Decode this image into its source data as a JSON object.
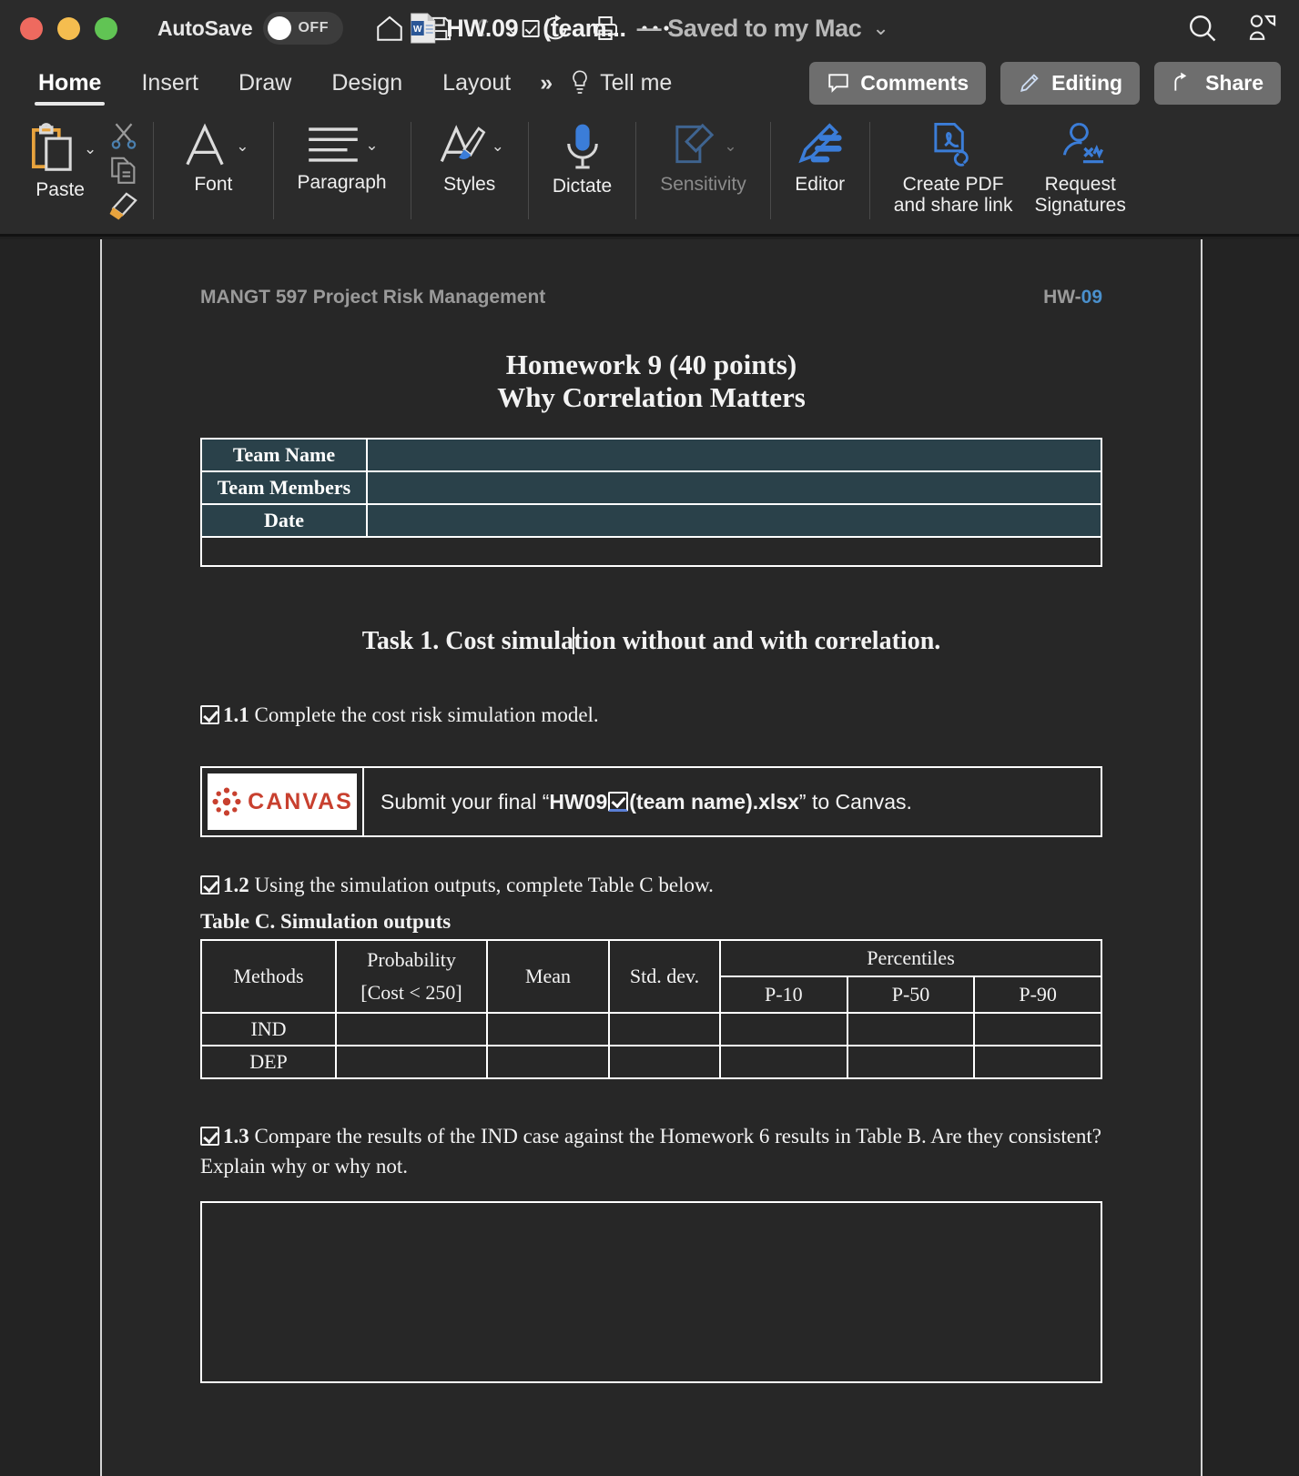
{
  "window": {
    "traffic_lights": [
      "close",
      "minimize",
      "maximize"
    ],
    "autosave_label": "AutoSave",
    "autosave_state": "OFF",
    "doc_title": "HW.09",
    "doc_title_tail": "(team...",
    "doc_status": "— Saved to my Mac",
    "quick_access": [
      "home-icon",
      "save-icon",
      "undo-icon",
      "redo-icon",
      "print-icon",
      "more-icon"
    ],
    "right_icons": [
      "search-icon",
      "collab-icon"
    ]
  },
  "ribbon": {
    "tabs": [
      {
        "label": "Home",
        "active": true
      },
      {
        "label": "Insert",
        "active": false
      },
      {
        "label": "Draw",
        "active": false
      },
      {
        "label": "Design",
        "active": false
      },
      {
        "label": "Layout",
        "active": false
      }
    ],
    "overflow": "»",
    "tell_me": "Tell me",
    "actions": [
      {
        "label": "Comments",
        "icon": "comment-icon"
      },
      {
        "label": "Editing",
        "icon": "pencil-icon"
      },
      {
        "label": "Share",
        "icon": "share-icon"
      }
    ],
    "groups": [
      {
        "label": "Paste",
        "icon": "clipboard-icon",
        "dropdown": true,
        "dim": false
      },
      {
        "label": "Font",
        "icon": "font-a-icon",
        "dropdown": true,
        "dim": false
      },
      {
        "label": "Paragraph",
        "icon": "paragraph-lines-icon",
        "dropdown": true,
        "dim": false
      },
      {
        "label": "Styles",
        "icon": "styles-brush-icon",
        "dropdown": true,
        "dim": false
      },
      {
        "label": "Dictate",
        "icon": "microphone-icon",
        "dropdown": false,
        "dim": false
      },
      {
        "label": "Sensitivity",
        "icon": "sensitivity-icon",
        "dropdown": true,
        "dim": true
      },
      {
        "label": "Editor",
        "icon": "editor-pen-icon",
        "dropdown": false,
        "dim": false
      },
      {
        "label": "Create PDF\nand share link",
        "icon": "pdf-link-icon",
        "dropdown": false,
        "dim": false
      },
      {
        "label": "Request\nSignatures",
        "icon": "signature-icon",
        "dropdown": false,
        "dim": false
      }
    ],
    "mini_tools": [
      "cut-scissors-icon",
      "copy-icon",
      "format-painter-icon"
    ]
  },
  "document": {
    "header_left": "MANGT 597 Project Risk Management",
    "header_right_gray": "HW-",
    "header_right_blue": "09",
    "title_line1": "Homework 9 (40 points)",
    "title_line2": "Why Correlation Matters",
    "team_table": {
      "rows": [
        {
          "label": "Team Name",
          "value": ""
        },
        {
          "label": "Team Members",
          "value": ""
        },
        {
          "label": "Date",
          "value": ""
        }
      ]
    },
    "task_heading_pre": "Task 1. Cost simula",
    "task_heading_post": "tion without and with correlation.",
    "item_1_1": {
      "number": "1.1",
      "text": "Complete the cost risk simulation model."
    },
    "canvas_box": {
      "logo_text": "CANVAS",
      "prefix": "Submit your final “",
      "bold_a": "HW09",
      "bold_b": "(team name).xlsx",
      "suffix": "” to Canvas."
    },
    "item_1_2": {
      "number": "1.2",
      "text": "Using the simulation outputs, complete Table C below."
    },
    "table_c_caption": "Table C. Simulation outputs",
    "table_c": {
      "headers": {
        "methods": "Methods",
        "probability_line1": "Probability",
        "probability_line2": "[Cost < 250]",
        "mean": "Mean",
        "std_dev": "Std. dev.",
        "percentiles": "Percentiles",
        "p10": "P-10",
        "p50": "P-50",
        "p90": "P-90"
      },
      "rows": [
        {
          "method": "IND",
          "probability": "",
          "mean": "",
          "std_dev": "",
          "p10": "",
          "p50": "",
          "p90": ""
        },
        {
          "method": "DEP",
          "probability": "",
          "mean": "",
          "std_dev": "",
          "p10": "",
          "p50": "",
          "p90": ""
        }
      ]
    },
    "item_1_3": {
      "number": "1.3",
      "text": "Compare the results of the IND case against the Homework 6 results in Table B. Are they consistent? Explain why or why not."
    },
    "answer_box": ""
  },
  "colors": {
    "window_chrome": "#2b2b2b",
    "workspace": "#232323",
    "page": "#272727",
    "table_teal": "#2a414a",
    "accent_blue": "#4a90cc",
    "canvas_red": "#c8402f",
    "ribbon_blue": "#3b7dd8",
    "paste_orange": "#e8a33d"
  }
}
